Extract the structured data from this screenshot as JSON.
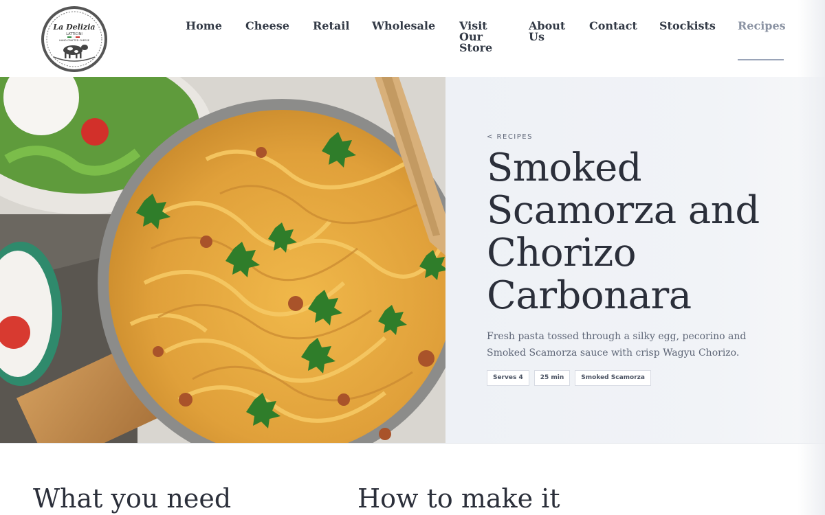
{
  "logo": {
    "brand_name": "La Delizia",
    "sub_name": "LATTICINI",
    "tagline": "HAND CRAFTED CHEESE"
  },
  "nav": {
    "items": [
      {
        "label": "Home"
      },
      {
        "label": "Cheese"
      },
      {
        "label": "Retail"
      },
      {
        "label": "Wholesale"
      },
      {
        "label": "Visit Our Store"
      },
      {
        "label": "About Us"
      },
      {
        "label": "Contact"
      },
      {
        "label": "Stockists"
      },
      {
        "label": "Recipes",
        "active": true
      }
    ]
  },
  "recipe": {
    "breadcrumb": "< RECIPES",
    "title": "Smoked Scamorza and Chorizo Carbonara",
    "description": "Fresh pasta tossed through a silky egg, pecorino and Smoked Scamorza sauce with crisp Wagyu Chorizo.",
    "tags": [
      "Serves 4",
      "25 min",
      "Smoked Scamorza"
    ]
  },
  "sections": {
    "ingredients_heading": "What you need",
    "method_heading": "How to make it"
  },
  "colors": {
    "text_dark": "#2b2f3a",
    "nav_active": "#8b93a3",
    "panel_bg": "#eef1f6",
    "pasta": "#e6a53c"
  }
}
